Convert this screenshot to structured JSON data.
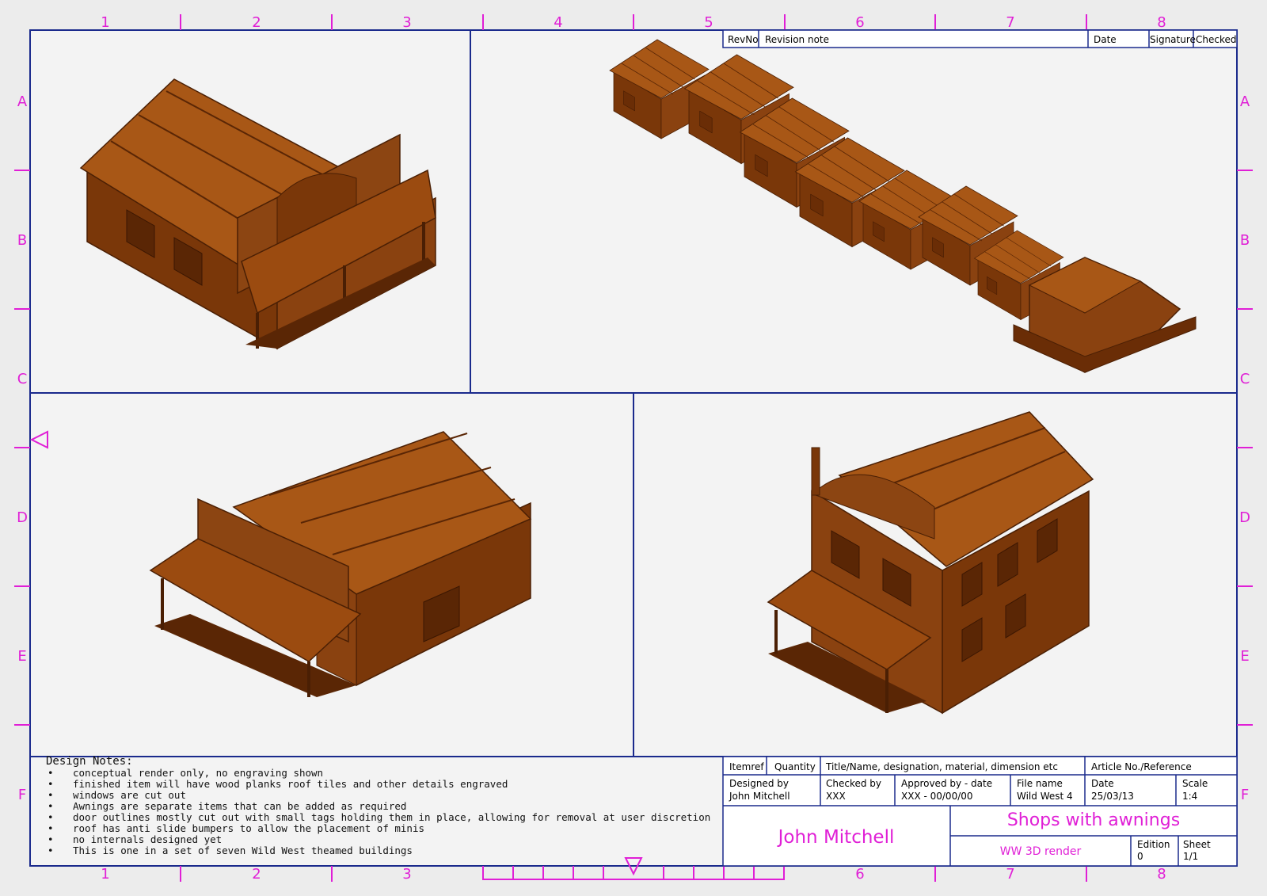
{
  "frame": {
    "col_labels": [
      "1",
      "2",
      "3",
      "4",
      "5",
      "6",
      "7",
      "8"
    ],
    "row_labels": [
      "A",
      "B",
      "C",
      "D",
      "E",
      "F"
    ],
    "bottom_col_labels": [
      "1",
      "2",
      "3",
      "6",
      "7",
      "8"
    ]
  },
  "revision_table": {
    "revno": "RevNo",
    "note": "Revision note",
    "date": "Date",
    "signature": "Signature",
    "checked": "Checked"
  },
  "notes": {
    "title": "Design Notes:",
    "bullet": "•",
    "items": [
      "conceptual render only, no engraving shown",
      "finished item will have wood planks roof tiles and other details engraved",
      "windows are cut out",
      "Awnings are separate items that can be added as required",
      "door outlines mostly cut out with small tags holding them in place, allowing for removal at user discretion",
      "roof has anti slide bumpers to allow the placement of minis",
      "no internals designed yet",
      "This is one in a set of seven Wild West theamed buildings"
    ]
  },
  "title_block": {
    "itemref": "Itemref",
    "quantity": "Quantity",
    "title_header": "Title/Name, designation, material, dimension etc",
    "article_header": "Article No./Reference",
    "designed_by_label": "Designed by",
    "designed_by": "John Mitchell",
    "checked_by_label": "Checked by",
    "checked_by": "XXX",
    "approved_label": "Approved by - date",
    "approved": "XXX - 00/00/00",
    "file_label": "File name",
    "file": "Wild West 4",
    "date_label": "Date",
    "date": "25/03/13",
    "scale_label": "Scale",
    "scale": "1:4",
    "company": "John Mitchell",
    "title": "Shops with awnings",
    "subtitle": "WW 3D render",
    "edition_label": "Edition",
    "edition": "0",
    "sheet_label": "Sheet",
    "sheet": "1/1"
  },
  "colors": {
    "magenta": "#e01fd6",
    "frame_blue": "#1a2a8c",
    "wood": "#9b4b10",
    "wood_light": "#b0601c",
    "wood_dark": "#6a2d06"
  }
}
